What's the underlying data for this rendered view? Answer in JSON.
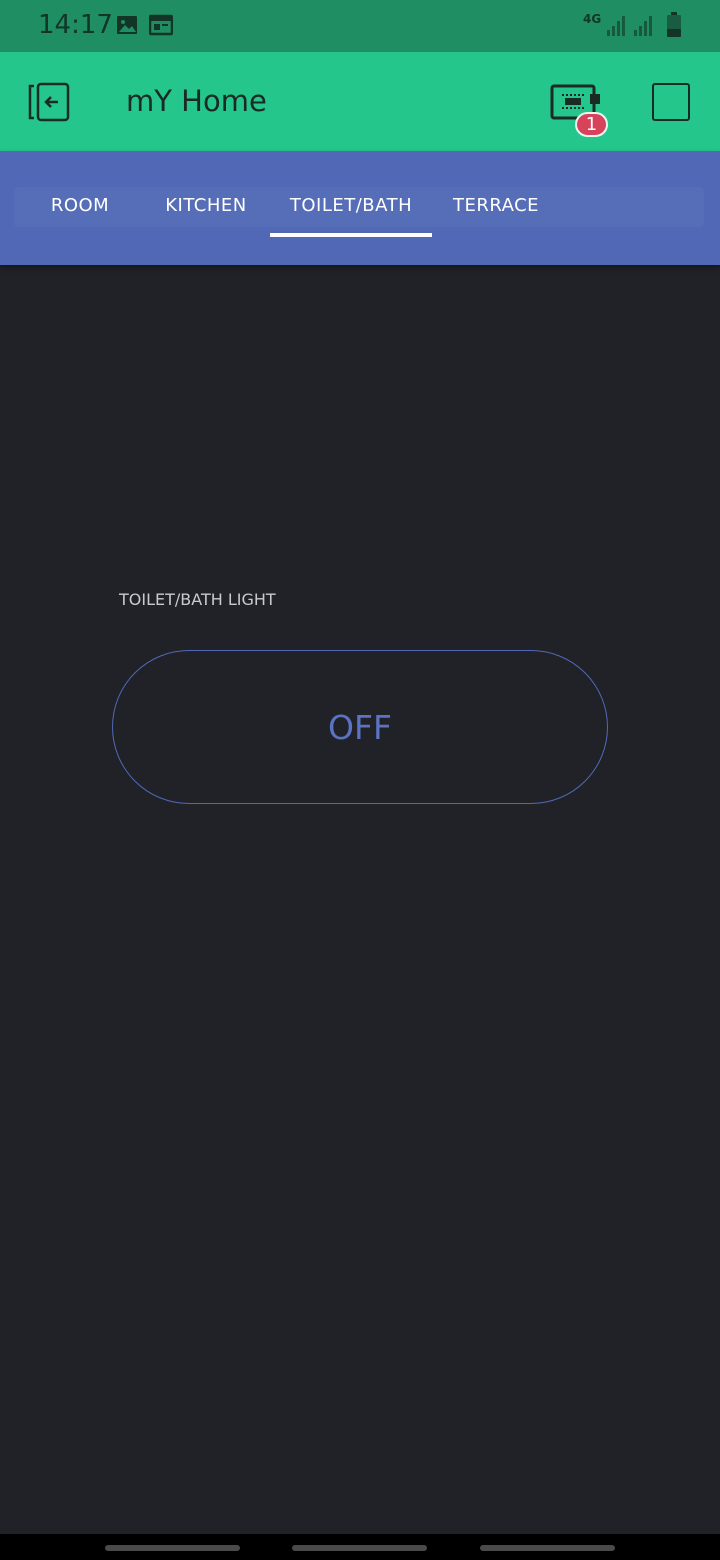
{
  "status_bar": {
    "time": "14:17",
    "network": "4G",
    "icons": [
      "image-icon",
      "calendar-icon",
      "signal-icon",
      "signal-icon",
      "battery-icon"
    ]
  },
  "app_bar": {
    "title": "mY Home",
    "device_badge_count": "1",
    "icons": [
      "exit-icon",
      "device-icon",
      "square-icon"
    ]
  },
  "tabs": [
    {
      "label": "ROOM",
      "active": false
    },
    {
      "label": "KITCHEN",
      "active": false
    },
    {
      "label": "TOILET/BATH",
      "active": true
    },
    {
      "label": "TERRACE",
      "active": false
    }
  ],
  "widget": {
    "label": "TOILET/BATH LIGHT",
    "state": "OFF"
  },
  "colors": {
    "status_bar": "#1f8f63",
    "app_bar": "#25c68b",
    "tab_bar": "#5168b6",
    "background": "#212228",
    "accent": "#5b73c2",
    "badge": "#d7435b"
  }
}
